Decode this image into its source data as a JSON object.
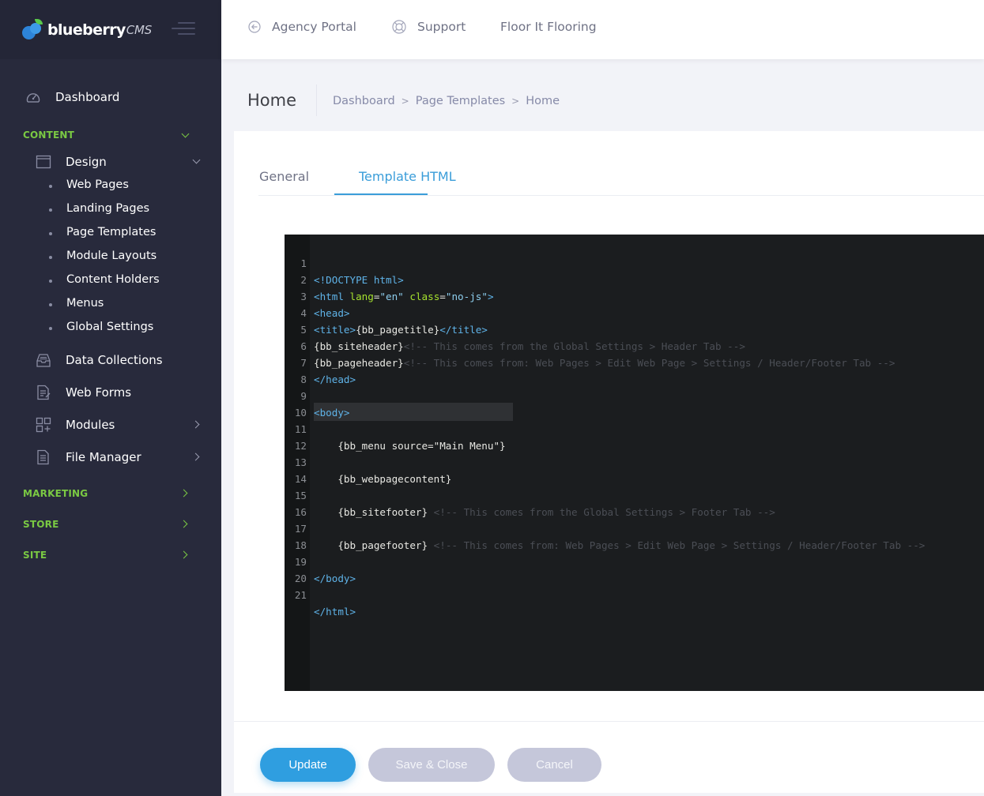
{
  "brand": {
    "name": "blueberry",
    "suffix": "CMS"
  },
  "topbar": {
    "agency_portal": "Agency Portal",
    "support": "Support",
    "site_name": "Floor It Flooring"
  },
  "sidebar": {
    "dashboard": "Dashboard",
    "content_section": "CONTENT",
    "design": "Design",
    "design_items": [
      "Web Pages",
      "Landing Pages",
      "Page Templates",
      "Module Layouts",
      "Content Holders",
      "Menus",
      "Global Settings"
    ],
    "data_collections": "Data Collections",
    "web_forms": "Web Forms",
    "modules": "Modules",
    "file_manager": "File Manager",
    "marketing_section": "MARKETING",
    "store_section": "STORE",
    "site_section": "SITE"
  },
  "subheader": {
    "title": "Home",
    "breadcrumb": [
      "Dashboard",
      "Page Templates",
      "Home"
    ],
    "separator": ">"
  },
  "tabs": {
    "general": "General",
    "template_html": "Template HTML"
  },
  "editor": {
    "line_numbers": [
      "1",
      "2",
      "3",
      "4",
      "5",
      "6",
      "7",
      "8",
      "9",
      "10",
      "11",
      "12",
      "13",
      "14",
      "15",
      "16",
      "17",
      "18",
      "19",
      "20",
      "21"
    ],
    "l1": "<!DOCTYPE html>",
    "l2_open": "<html",
    "l2_lang": " lang",
    "l2_eq1": "=",
    "l2_langval": "\"en\"",
    "l2_class": " class",
    "l2_eq2": "=",
    "l2_classval": "\"no-js\"",
    "l2_close": ">",
    "l3": "<head>",
    "l4_open": "<title>",
    "l4_text": "{bb_pagetitle}",
    "l4_close": "</title>",
    "l5_text": "{bb_siteheader}",
    "l5_comment": "<!-- This comes from the Global Settings > Header Tab -->",
    "l6_text": "{bb_pageheader}",
    "l6_comment": "<!-- This comes from: Web Pages > Edit Web Page > Settings / Header/Footer Tab -->",
    "l7": "</head>",
    "l9": "<body>",
    "l11": "    {bb_menu source=\"Main Menu\"}",
    "l13": "    {bb_webpagecontent}",
    "l15_text": "    {bb_sitefooter} ",
    "l15_comment": "<!-- This comes from the Global Settings > Footer Tab -->",
    "l17_text": "    {bb_pagefooter} ",
    "l17_comment": "<!-- This comes from: Web Pages > Edit Web Page > Settings / Header/Footer Tab -->",
    "l19": "</body>",
    "l21": "</html>"
  },
  "buttons": {
    "update": "Update",
    "save_close": "Save & Close",
    "cancel": "Cancel"
  },
  "colors": {
    "accent": "#3a9dd9",
    "section_green": "#7ac943",
    "sidebar_bg": "#282a3c"
  }
}
